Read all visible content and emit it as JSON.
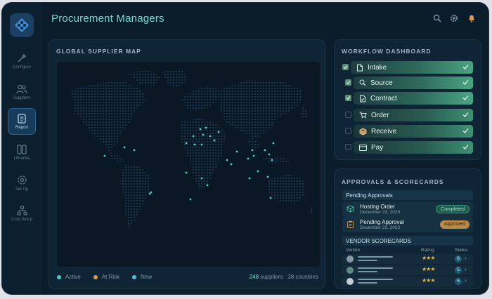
{
  "app": {
    "title": "Procurement Managers"
  },
  "sidebar": {
    "items": [
      {
        "label": "Configure",
        "icon": "wand-icon"
      },
      {
        "label": "Suppliers",
        "icon": "users-icon"
      },
      {
        "label": "Report",
        "icon": "document-icon",
        "active": true
      },
      {
        "label": "Libraries",
        "icon": "columns-icon"
      },
      {
        "label": "Set Up",
        "icon": "settings-circle-icon"
      },
      {
        "label": "Cust Setup",
        "icon": "hierarchy-icon"
      }
    ]
  },
  "header": {
    "icons": [
      "search-icon",
      "gear-icon",
      "bell-icon"
    ]
  },
  "map": {
    "title": "GLOBAL SUPPLIER MAP",
    "legend": [
      {
        "label": "Active",
        "color": "#4fc7c1"
      },
      {
        "label": "At Risk",
        "color": "#d69b5a"
      },
      {
        "label": "New",
        "color": "#5ab9d6"
      }
    ],
    "stats": {
      "count": "248",
      "text": "suppliers · 38 countries"
    }
  },
  "workflow": {
    "title": "WORKFLOW DASHBOARD",
    "steps": [
      {
        "label": "Intake",
        "checked": true,
        "icon": "file-icon"
      },
      {
        "label": "Source",
        "checked": true,
        "icon": "search-icon"
      },
      {
        "label": "Contract",
        "checked": true,
        "icon": "contract-icon"
      },
      {
        "label": "Order",
        "checked": false,
        "icon": "cart-icon"
      },
      {
        "label": "Receive",
        "checked": false,
        "icon": "box-icon"
      },
      {
        "label": "Pay",
        "checked": false,
        "icon": "card-icon"
      }
    ]
  },
  "approvals": {
    "title": "APPROVALS & SCORECARDS",
    "pending_title": "Pending Approvals",
    "items": [
      {
        "name": "Hosting Order",
        "date": "December 23, 2023",
        "status": "Completed"
      },
      {
        "name": "Pending Approval",
        "date": "December 23, 2023",
        "status": "Approved"
      }
    ],
    "scorecards": {
      "title": "VENDOR SCORECARDS",
      "columns": {
        "vendor": "Vendor",
        "rating": "Rating",
        "status": "Status"
      },
      "rows": [
        {
          "stars": "★★★",
          "status": "6"
        },
        {
          "stars": "★★★",
          "status": "5"
        },
        {
          "stars": "★★★",
          "status": "5"
        }
      ]
    }
  },
  "colors": {
    "accent": "#79d7d3",
    "background": "#0b1c2b",
    "panel": "#0f2434"
  }
}
